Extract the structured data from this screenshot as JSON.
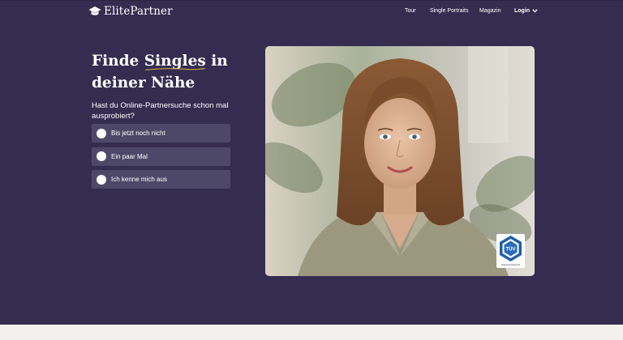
{
  "header": {
    "logo_text": "ElitePartner",
    "logo_icon": "graduation-cap-icon",
    "nav": {
      "tour": "Tour",
      "portraits": "Single Portraits",
      "magazin": "Magazin",
      "login": "Login"
    }
  },
  "hero": {
    "headline_pre": "Finde ",
    "headline_highlight": "Singles",
    "headline_post": " in",
    "headline_line2": "deiner Nähe",
    "question": "Hast du Online-Partnersuche schon mal ausprobiert?",
    "options": [
      {
        "label": "Bis jetzt noch nicht"
      },
      {
        "label": "Ein paar Mal"
      },
      {
        "label": "Ich kenne mich aus"
      }
    ]
  },
  "badge": {
    "brand": "TÜV",
    "caption": "Datenschutzgeprüft"
  },
  "colors": {
    "hero_background": "#342d50",
    "option_background": "#4e4868",
    "accent_underline": "#c4a44a",
    "page_background": "#f3f1ee"
  }
}
